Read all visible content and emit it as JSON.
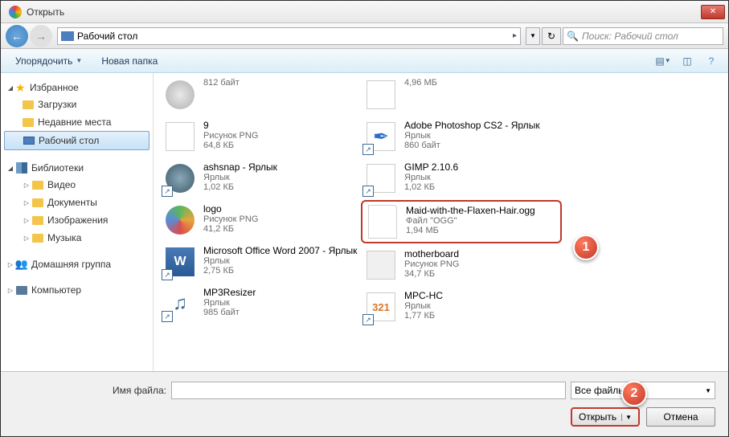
{
  "window": {
    "title": "Открыть"
  },
  "address": {
    "location": "Рабочий стол",
    "arrow": "▸",
    "search_placeholder": "Поиск: Рабочий стол"
  },
  "toolbar": {
    "organize": "Упорядочить",
    "new_folder": "Новая папка"
  },
  "sidebar": {
    "favorites": {
      "label": "Избранное",
      "items": [
        {
          "label": "Загрузки"
        },
        {
          "label": "Недавние места"
        },
        {
          "label": "Рабочий стол"
        }
      ]
    },
    "libraries": {
      "label": "Библиотеки",
      "items": [
        {
          "label": "Видео"
        },
        {
          "label": "Документы"
        },
        {
          "label": "Изображения"
        },
        {
          "label": "Музыка"
        }
      ]
    },
    "homegroup": {
      "label": "Домашняя группа"
    },
    "computer": {
      "label": "Компьютер"
    }
  },
  "files": {
    "col1": [
      {
        "name": "",
        "type": "",
        "size": "812 байт"
      },
      {
        "name": "9",
        "type": "Рисунок PNG",
        "size": "64,8 КБ"
      },
      {
        "name": "ashsnap - Ярлык",
        "type": "Ярлык",
        "size": "1,02 КБ"
      },
      {
        "name": "logo",
        "type": "Рисунок PNG",
        "size": "41,2 КБ"
      },
      {
        "name": "Microsoft Office Word 2007 - Ярлык",
        "type": "Ярлык",
        "size": "2,75 КБ"
      },
      {
        "name": "MP3Resizer",
        "type": "Ярлык",
        "size": "985 байт"
      }
    ],
    "col2": [
      {
        "name": "",
        "type": "",
        "size": "4,96 МБ"
      },
      {
        "name": "Adobe Photoshop CS2 - Ярлык",
        "type": "Ярлык",
        "size": "860 байт"
      },
      {
        "name": "GIMP 2.10.6",
        "type": "Ярлык",
        "size": "1,02 КБ"
      },
      {
        "name": "Maid-with-the-Flaxen-Hair.ogg",
        "type": "Файл \"OGG\"",
        "size": "1,94 МБ"
      },
      {
        "name": "motherboard",
        "type": "Рисунок PNG",
        "size": "34,7 КБ"
      },
      {
        "name": "MPC-HC",
        "type": "Ярлык",
        "size": "1,77 КБ"
      }
    ]
  },
  "bottom": {
    "filename_label": "Имя файла:",
    "filename_value": "",
    "filetype": "Все файлы",
    "open": "Открыть",
    "cancel": "Отмена"
  },
  "callouts": {
    "one": "1",
    "two": "2"
  }
}
